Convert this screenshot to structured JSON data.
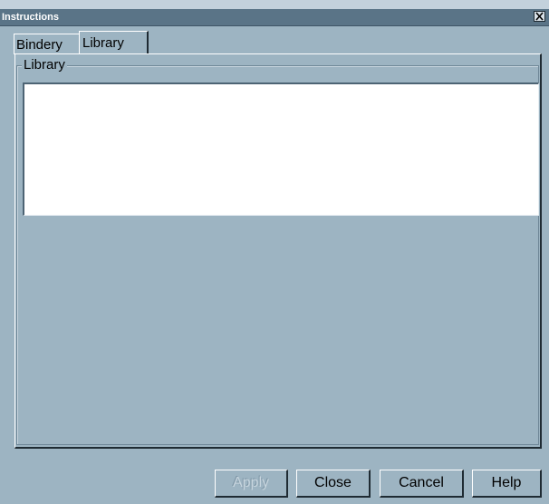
{
  "window": {
    "title": "Instructions"
  },
  "tabs": [
    {
      "label": "Bindery",
      "selected": false
    },
    {
      "label": "Library",
      "selected": true
    }
  ],
  "group": {
    "label": "Library",
    "list_items": []
  },
  "buttons": {
    "apply": {
      "label": "Apply",
      "enabled": false
    },
    "close": {
      "label": "Close",
      "enabled": true
    },
    "cancel": {
      "label": "Cancel",
      "enabled": true
    },
    "help": {
      "label": "Help",
      "enabled": true
    }
  },
  "icons": {
    "title_close": "close-icon"
  },
  "colors": {
    "window_bg": "#9db4c2",
    "titlebar": "#5a7487",
    "list_bg": "#ffffff"
  }
}
